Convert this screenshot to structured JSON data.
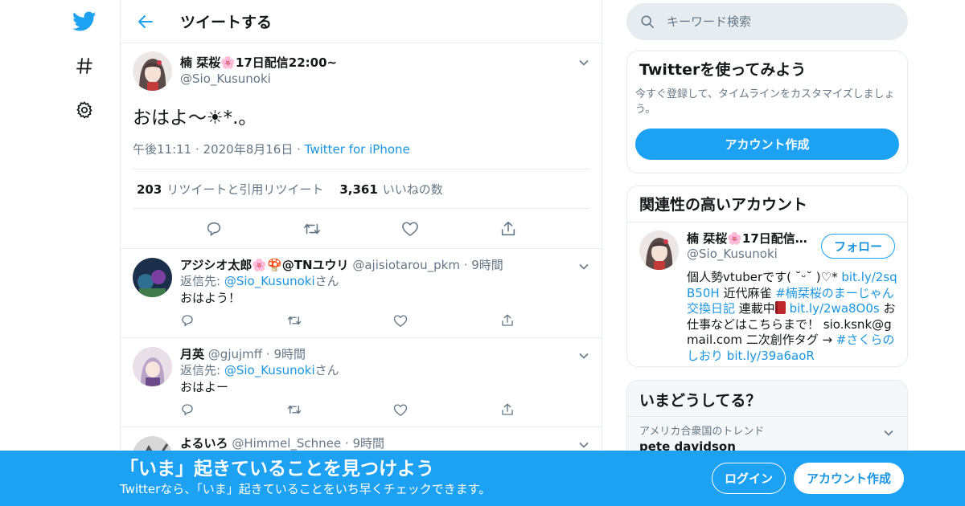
{
  "colors": {
    "accent": "#1da1f2",
    "link": "#1b95e0",
    "text": "#14171a",
    "secondary": "#657786",
    "border": "#e6ecf0"
  },
  "nav": {
    "icons": [
      "twitter-logo-icon",
      "hashtag-icon",
      "gear-icon"
    ]
  },
  "header": {
    "title": "ツイートする"
  },
  "tweet": {
    "name": "楠 栞桜🌸17日配信22:00~",
    "handle": "@Sio_Kusunoki",
    "text": "おはよ〜☀*.。",
    "time": "午後11:11",
    "date": "2020年8月16日",
    "via": "Twitter for iPhone",
    "retweets_count": "203",
    "retweets_label": "リツイートと引用リツイート",
    "likes_count": "3,361",
    "likes_label": "いいねの数"
  },
  "replies": [
    {
      "name": "アジシオ太郎🌸🍄@TNユウリ",
      "handle": "@ajisiotarou_pkm",
      "time": "9時間",
      "reply_prefix": "返信先: ",
      "reply_to": "@Sio_Kusunoki",
      "reply_suffix": "さん",
      "text": "おはよう！"
    },
    {
      "name": "月英",
      "handle": "@gjujmff",
      "time": "9時間",
      "reply_prefix": "返信先: ",
      "reply_to": "@Sio_Kusunoki",
      "reply_suffix": "さん",
      "text": "おはよー"
    },
    {
      "name": "よるいろ",
      "handle": "@Himmel_Schnee",
      "time": "9時間"
    }
  ],
  "search": {
    "placeholder": "キーワード検索"
  },
  "signup_card": {
    "title": "Twitterを使ってみよう",
    "desc": "今すぐ登録して、タイムラインをカスタマイズしましょう。",
    "button": "アカウント作成"
  },
  "related": {
    "title": "関連性の高いアカウント",
    "name": "楠 栞桜🌸17日配信2...",
    "handle": "@Sio_Kusunoki",
    "follow": "フォロー",
    "bio_1": "個人勢vtuberです( ˘ᵕ˘ )♡*",
    "bio_link_1": "bit.ly/2sqB50H",
    "bio_2": " 近代麻雀 ",
    "bio_tag_1": "#楠栞桜のまーじゃん交換日記",
    "bio_3": " 連載中",
    "bio_link_2": "bit.ly/2wa8O0s",
    "bio_4": " お仕事などはこちらまで！ sio.ksnk@gmail.com 二次創作タグ → ",
    "bio_tag_2": "#さくらのしおり",
    "bio_link_3": "bit.ly/39a6aoR"
  },
  "trends": {
    "title": "いまどうしてる？",
    "location": "アメリカ合衆国のトレンド",
    "first": "pete davidson"
  },
  "banner": {
    "title": "「いま」起きていることを見つけよう",
    "subtitle": "Twitterなら、「いま」起きていることをいち早くチェックできます。",
    "login": "ログイン",
    "signup": "アカウント作成"
  }
}
